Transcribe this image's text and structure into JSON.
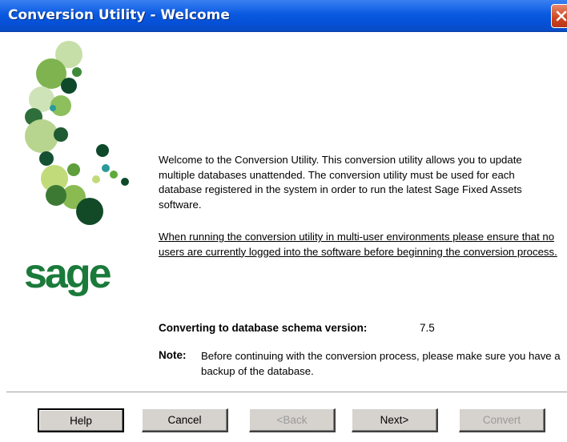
{
  "window": {
    "title": "Conversion Utility - Welcome"
  },
  "branding": {
    "logo_text": "sage",
    "logo_color": "#1a7a3a"
  },
  "content": {
    "welcome_text": "Welcome to the Conversion Utility. This conversion utility allows you to update multiple databases unattended. The conversion utility must be used for each database registered in the system in order to run the latest Sage Fixed Assets software.",
    "warning_text": "When running the conversion utility in multi-user environments please ensure that no users are currently logged into the software before beginning the conversion process.",
    "schema_label": "Converting to database schema version:",
    "schema_version": "7.5",
    "note_label": "Note:",
    "note_text": "Before continuing with the conversion process, please make sure you have a backup of the database."
  },
  "buttons": {
    "help": "Help",
    "cancel": "Cancel",
    "back": "<Back",
    "next": "Next>",
    "convert": "Convert"
  },
  "colors": {
    "titlebar": "#0a5ae0",
    "close": "#cf4420",
    "button_face": "#d6d3ce",
    "disabled_text": "#9a9a9a"
  }
}
